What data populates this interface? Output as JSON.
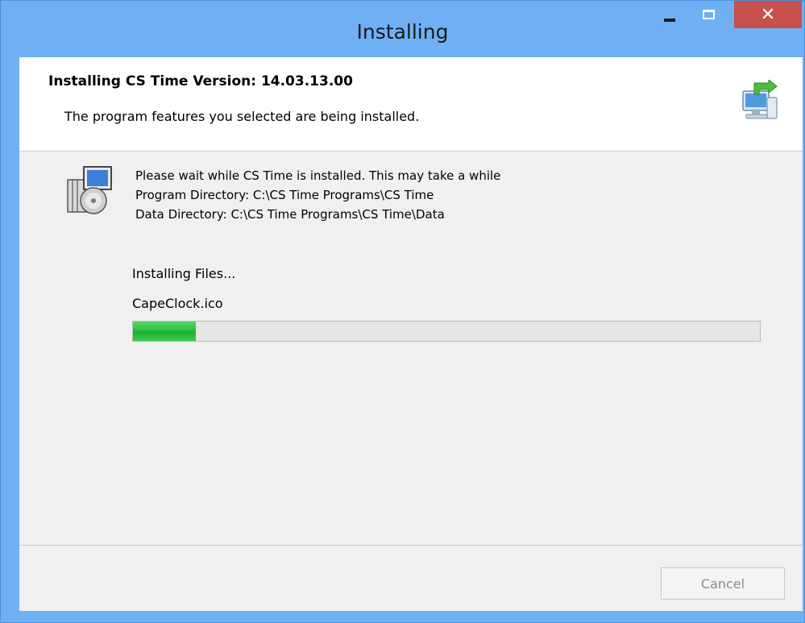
{
  "window": {
    "title": "Installing",
    "controls": {
      "minimize_icon": "minimize-icon",
      "maximize_icon": "maximize-icon",
      "close_glyph": "✕"
    }
  },
  "header": {
    "title": "Installing CS Time Version: 14.03.13.00",
    "subtitle": "The program features you selected are being installed.",
    "icon": "computer-install-icon"
  },
  "body": {
    "icon": "installer-package-icon",
    "info_lines": [
      "Please wait while CS Time is installed. This may take a while",
      "Program Directory: C:\\CS Time Programs\\CS Time",
      "Data Directory: C:\\CS Time Programs\\CS Time\\Data"
    ],
    "status": "Installing Files...",
    "current_file": "CapeClock.ico",
    "progress_percent": 10
  },
  "footer": {
    "cancel_label": "Cancel",
    "cancel_enabled": false
  },
  "colors": {
    "titlebar": "#6fb0f5",
    "close_button": "#c7504c",
    "progress_fill": "#2bbf3f"
  }
}
